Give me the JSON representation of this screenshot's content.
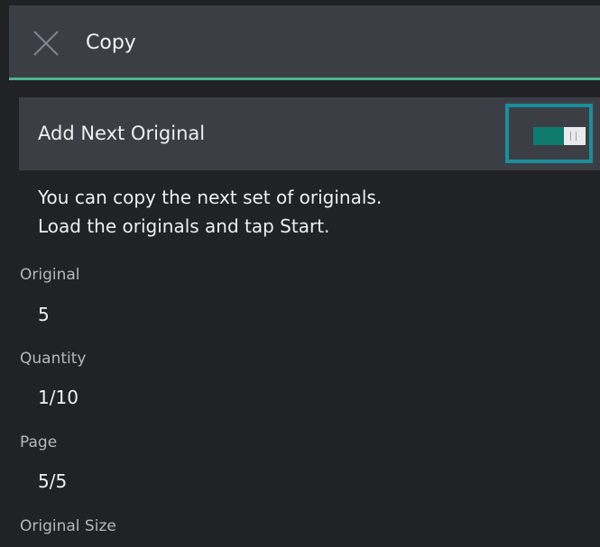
{
  "header": {
    "title": "Copy",
    "close_icon": "close-icon"
  },
  "add_next_original": {
    "label": "Add Next Original",
    "toggle_on": true,
    "accent_color": "#0f7a6e",
    "focus_color": "#1a8f9a"
  },
  "message": {
    "line1": "You can copy the next set of originals.",
    "line2": "Load the originals and tap Start."
  },
  "fields": [
    {
      "label": "Original",
      "value": "5"
    },
    {
      "label": "Quantity",
      "value": "1/10"
    },
    {
      "label": "Page",
      "value": "5/5"
    },
    {
      "label": "Original Size",
      "value": ""
    }
  ]
}
